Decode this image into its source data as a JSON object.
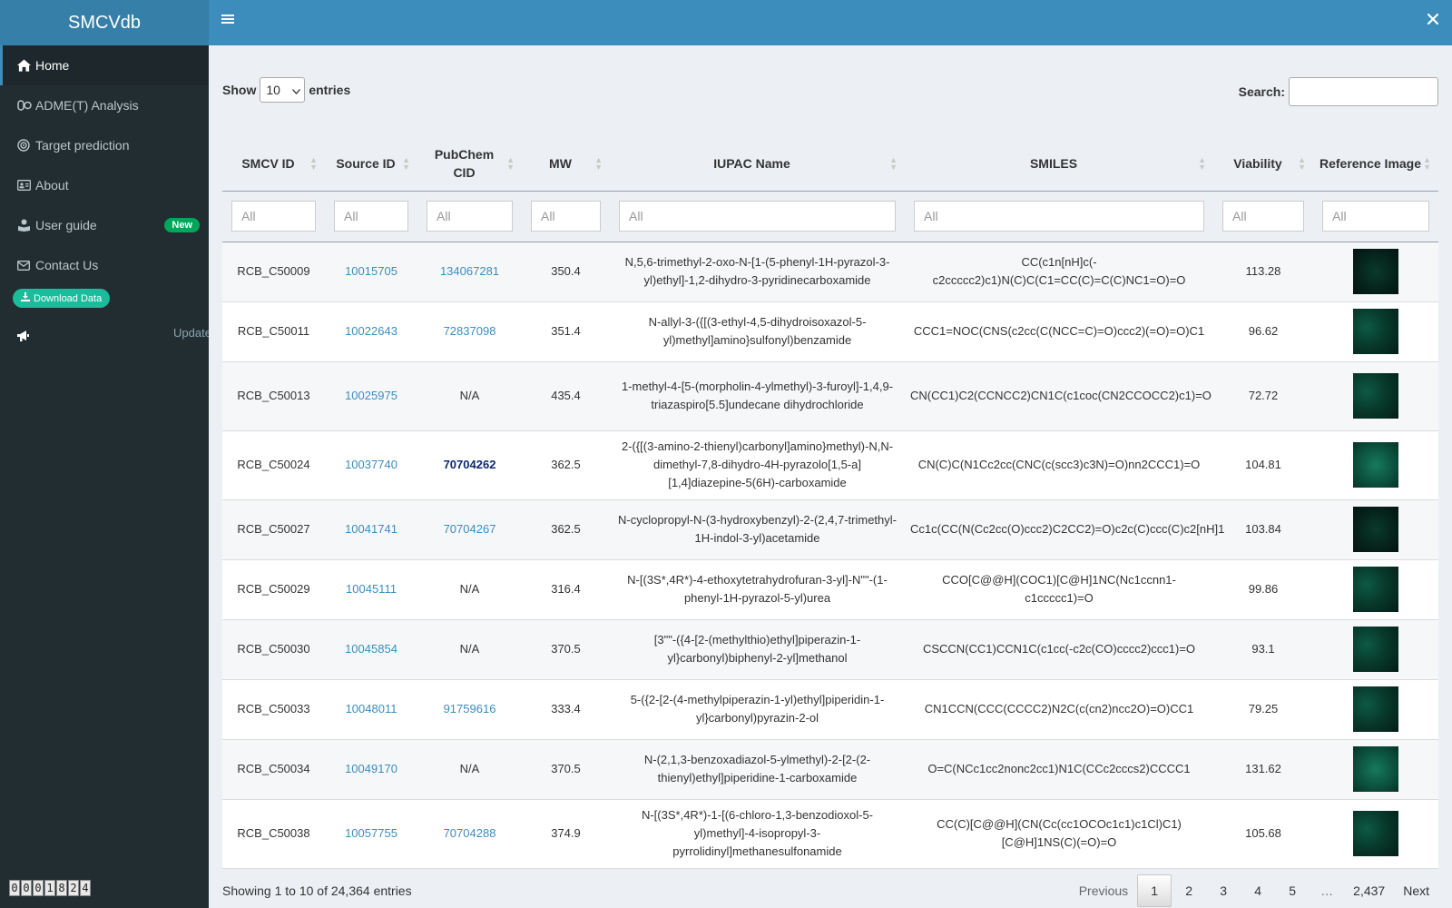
{
  "brand": "SMCVdb",
  "sidebar": {
    "items": [
      {
        "label": "Home"
      },
      {
        "label": "ADME(T) Analysis"
      },
      {
        "label": "Target prediction"
      },
      {
        "label": "About"
      },
      {
        "label": "User guide",
        "badge": "New"
      },
      {
        "label": "Contact Us"
      }
    ],
    "download_label": "Download Data",
    "ticker_text": "Update",
    "counter": [
      "0",
      "0",
      "0",
      "1",
      "8",
      "2",
      "4"
    ]
  },
  "controls": {
    "show_label": "Show",
    "entries_value": "10",
    "entries_label": "entries",
    "search_label": "Search:"
  },
  "table": {
    "headers": [
      "SMCV ID",
      "Source ID",
      "PubChem CID",
      "MW",
      "IUPAC Name",
      "SMILES",
      "Viability",
      "Reference Image"
    ],
    "filter_placeholder": "All",
    "rows": [
      {
        "smcv": "RCB_C50009",
        "source": "10015705",
        "cid": "134067281",
        "mw": "350.4",
        "iupac": "N,5,6-trimethyl-2-oxo-N-[1-(5-phenyl-1H-pyrazol-3-yl)ethyl]-1,2-dihydro-3-pyridinecarboxamide",
        "smiles": "CC(c1n[nH]c(-c2ccccc2)c1)N(C)C(C1=CC(C)=C(C)NC1=O)=O",
        "viability": "113.28"
      },
      {
        "smcv": "RCB_C50011",
        "source": "10022643",
        "cid": "72837098",
        "mw": "351.4",
        "iupac": "N-allyl-3-({[(3-ethyl-4,5-dihydroisoxazol-5-yl)methyl]amino}sulfonyl)benzamide",
        "smiles": "CCC1=NOC(CNS(c2cc(C(NCC=C)=O)ccc2)(=O)=O)C1",
        "viability": "96.62"
      },
      {
        "smcv": "RCB_C50013",
        "source": "10025975",
        "cid": "N/A",
        "mw": "435.4",
        "iupac": "1-methyl-4-[5-(morpholin-4-ylmethyl)-3-furoyl]-1,4,9-triazaspiro[5.5]undecane dihydrochloride",
        "smiles": "CN(CC1)C2(CCNCC2)CN1C(c1coc(CN2CCOCC2)c1)=O",
        "viability": "72.72"
      },
      {
        "smcv": "RCB_C50024",
        "source": "10037740",
        "cid": "70704262",
        "mw": "362.5",
        "iupac": "2-({[(3-amino-2-thienyl)carbonyl]amino}methyl)-N,N-dimethyl-7,8-dihydro-4H-pyrazolo[1,5-a][1,4]diazepine-5(6H)-carboxamide",
        "smiles": "CN(C)C(N1Cc2cc(CNC(c(scc3)c3N)=O)nn2CCC1)=O",
        "viability": "104.81"
      },
      {
        "smcv": "RCB_C50027",
        "source": "10041741",
        "cid": "70704267",
        "mw": "362.5",
        "iupac": "N-cyclopropyl-N-(3-hydroxybenzyl)-2-(2,4,7-trimethyl-1H-indol-3-yl)acetamide",
        "smiles": "Cc1c(CC(N(Cc2cc(O)ccc2)C2CC2)=O)c2c(C)ccc(C)c2[nH]1",
        "viability": "103.84"
      },
      {
        "smcv": "RCB_C50029",
        "source": "10045111",
        "cid": "N/A",
        "mw": "316.4",
        "iupac": "N-[(3S*,4R*)-4-ethoxytetrahydrofuran-3-yl]-N\"\"-(1-phenyl-1H-pyrazol-5-yl)urea",
        "smiles": "CCO[C@@H](COC1)[C@H]1NC(Nc1ccnn1-c1ccccc1)=O",
        "viability": "99.86"
      },
      {
        "smcv": "RCB_C50030",
        "source": "10045854",
        "cid": "N/A",
        "mw": "370.5",
        "iupac": "[3\"\"-({4-[2-(methylthio)ethyl]piperazin-1-yl}carbonyl)biphenyl-2-yl]methanol",
        "smiles": "CSCCN(CC1)CCN1C(c1cc(-c2c(CO)cccc2)ccc1)=O",
        "viability": "93.1"
      },
      {
        "smcv": "RCB_C50033",
        "source": "10048011",
        "cid": "91759616",
        "mw": "333.4",
        "iupac": "5-({2-[2-(4-methylpiperazin-1-yl)ethyl]piperidin-1-yl}carbonyl)pyrazin-2-ol",
        "smiles": "CN1CCN(CCC(CCCC2)N2C(c(cn2)ncc2O)=O)CC1",
        "viability": "79.25"
      },
      {
        "smcv": "RCB_C50034",
        "source": "10049170",
        "cid": "N/A",
        "mw": "370.5",
        "iupac": "N-(2,1,3-benzoxadiazol-5-ylmethyl)-2-[2-(2-thienyl)ethyl]piperidine-1-carboxamide",
        "smiles": "O=C(NCc1cc2nonc2cc1)N1C(CCc2cccs2)CCCC1",
        "viability": "131.62"
      },
      {
        "smcv": "RCB_C50038",
        "source": "10057755",
        "cid": "70704288",
        "mw": "374.9",
        "iupac": "N-[(3S*,4R*)-1-[(6-chloro-1,3-benzodioxol-5-yl)methyl]-4-isopropyl-3-pyrrolidinyl]methanesulfonamide",
        "smiles": "CC(C)[C@@H](CN(Cc(cc1OCOc1c1)c1Cl)C1)[C@H]1NS(C)(=O)=O",
        "viability": "105.68"
      }
    ]
  },
  "footer": {
    "info": "Showing 1 to 10 of 24,364 entries",
    "previous": "Previous",
    "pages": [
      "1",
      "2",
      "3",
      "4",
      "5",
      "…",
      "2,437"
    ],
    "next": "Next"
  }
}
